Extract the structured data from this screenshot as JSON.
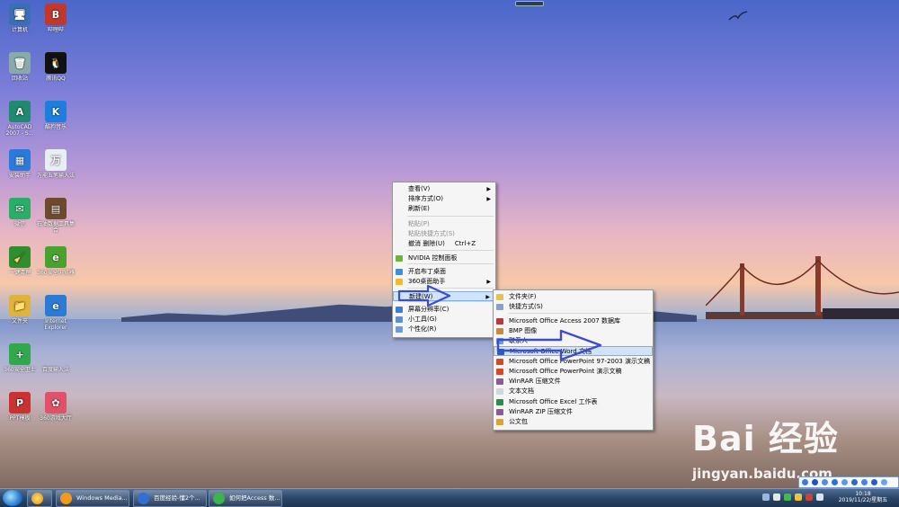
{
  "desktop_icons": [
    {
      "label": "计算机",
      "color": "#3a6fb6",
      "glyph": "🖥"
    },
    {
      "label": "哔哩哔",
      "color": "#c0392b",
      "glyph": "B"
    },
    {
      "label": "回收站",
      "color": "#8aa",
      "glyph": "🗑"
    },
    {
      "label": "腾讯QQ",
      "color": "#111",
      "glyph": "🐧"
    },
    {
      "label": "AutoCAD 2007 - S...",
      "color": "#1f8a70",
      "glyph": "A"
    },
    {
      "label": "酷狗音乐",
      "color": "#1c7fe0",
      "glyph": "K"
    },
    {
      "label": "安装助手",
      "color": "#2a7ad9",
      "glyph": "▦"
    },
    {
      "label": "万能五笔输入法",
      "color": "#e8eef5",
      "glyph": "万"
    },
    {
      "label": "微信",
      "color": "#2aae67",
      "glyph": "✉"
    },
    {
      "label": "石油数据工具集合",
      "color": "#6d4a2e",
      "glyph": "▤"
    },
    {
      "label": "一键清理",
      "color": "#2f8f2f",
      "glyph": "🧹"
    },
    {
      "label": "360安全浏览器",
      "color": "#49a12e",
      "glyph": "e"
    },
    {
      "label": "文件夹",
      "color": "#e0b33c",
      "glyph": "📁"
    },
    {
      "label": "Internet Explorer",
      "color": "#2b7ad6",
      "glyph": "e"
    },
    {
      "label": "360安全卫士",
      "color": "#30a84b",
      "glyph": "+"
    },
    {
      "label": "百度输入法",
      "color": "transparent",
      "glyph": ""
    },
    {
      "label": "PPT模板",
      "color": "#c9322e",
      "glyph": "P"
    },
    {
      "label": "360游戏大厅",
      "color": "#e0526a",
      "glyph": "✿"
    }
  ],
  "context_menu": {
    "items": [
      {
        "label": "查看(V)",
        "arrow": "▶"
      },
      {
        "label": "排序方式(O)",
        "arrow": "▶"
      },
      {
        "label": "刷新(E)"
      },
      {
        "label": "粘贴(P)",
        "disabled": true
      },
      {
        "label": "粘贴快捷方式(S)",
        "disabled": true
      },
      {
        "label": "撤消 删除(U)",
        "shortcut": "Ctrl+Z"
      },
      {
        "label": "NVIDIA 控制面板"
      },
      {
        "label": "开启布丁桌面"
      },
      {
        "label": "360桌面助手",
        "arrow": "▶"
      },
      {
        "label": "新建(W)",
        "arrow": "▶"
      },
      {
        "label": "屏幕分辨率(C)"
      },
      {
        "label": "小工具(G)"
      },
      {
        "label": "个性化(R)"
      }
    ]
  },
  "new_submenu": {
    "items": [
      {
        "label": "文件夹(F)"
      },
      {
        "label": "快捷方式(S)"
      },
      {
        "label": "Microsoft Office Access 2007 数据库"
      },
      {
        "label": "BMP 图像"
      },
      {
        "label": "联系人"
      },
      {
        "label": "Microsoft Office Word 文档"
      },
      {
        "label": "Microsoft Office PowerPoint 97-2003 演示文稿"
      },
      {
        "label": "Microsoft Office PowerPoint 演示文稿"
      },
      {
        "label": "WinRAR 压缩文件"
      },
      {
        "label": "文本文档"
      },
      {
        "label": "Microsoft Office Excel 工作表"
      },
      {
        "label": "WinRAR ZIP 压缩文件"
      },
      {
        "label": "公文包"
      }
    ]
  },
  "taskbar": {
    "buttons": [
      {
        "label": "Windows Media...",
        "color": "#f39a1b"
      },
      {
        "label": "百度经验-懂2个...",
        "color": "#2f6fd6"
      },
      {
        "label": "如何把Access 数...",
        "color": "#3bb54a"
      }
    ],
    "clock_time": "10:18",
    "clock_date": "2019/11/22/星期五"
  },
  "watermark": {
    "brand": "Bai 经验",
    "url": "jingyan.baidu.com"
  }
}
